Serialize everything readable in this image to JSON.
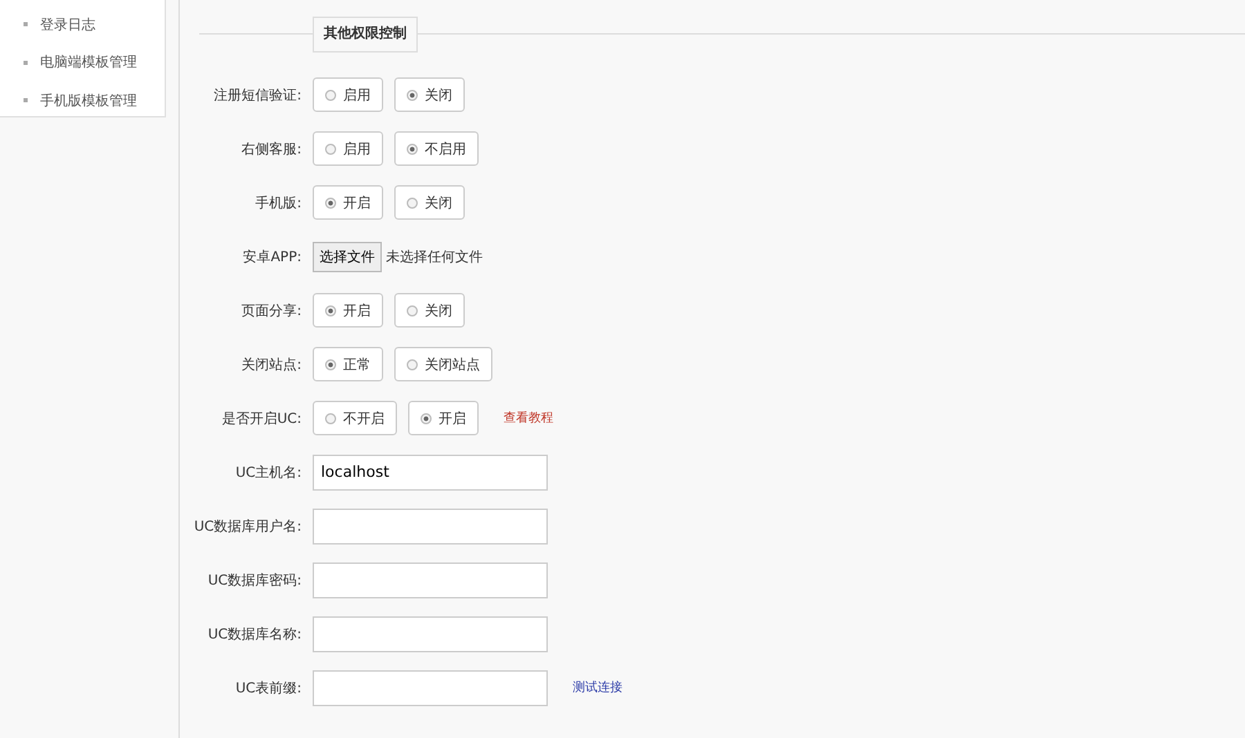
{
  "sidebar": {
    "items": [
      {
        "label": "登录日志"
      },
      {
        "label": "电脑端模板管理"
      },
      {
        "label": "手机版模板管理"
      }
    ]
  },
  "section": {
    "legend": "其他权限控制"
  },
  "rows": [
    {
      "kind": "radio",
      "label": "注册短信验证:",
      "options": [
        {
          "label": "启用",
          "selected": false
        },
        {
          "label": "关闭",
          "selected": true
        }
      ]
    },
    {
      "kind": "radio",
      "label": "右侧客服:",
      "options": [
        {
          "label": "启用",
          "selected": false
        },
        {
          "label": "不启用",
          "selected": true
        }
      ]
    },
    {
      "kind": "radio",
      "label": "手机版:",
      "options": [
        {
          "label": "开启",
          "selected": true
        },
        {
          "label": "关闭",
          "selected": false
        }
      ]
    },
    {
      "kind": "file",
      "label": "安卓APP:",
      "button": "选择文件",
      "status": "未选择任何文件"
    },
    {
      "kind": "radio",
      "label": "页面分享:",
      "options": [
        {
          "label": "开启",
          "selected": true
        },
        {
          "label": "关闭",
          "selected": false
        }
      ]
    },
    {
      "kind": "radio",
      "label": "关闭站点:",
      "options": [
        {
          "label": "正常",
          "selected": true
        },
        {
          "label": "关闭站点",
          "selected": false
        }
      ]
    },
    {
      "kind": "radio",
      "label": "是否开启UC:",
      "options": [
        {
          "label": "不开启",
          "selected": false
        },
        {
          "label": "开启",
          "selected": true
        }
      ],
      "link": {
        "text": "查看教程",
        "color": "#c0392b"
      }
    },
    {
      "kind": "input",
      "label": "UC主机名:",
      "value": "localhost"
    },
    {
      "kind": "input",
      "label": "UC数据库用户名:"
    },
    {
      "kind": "input",
      "label": "UC数据库密码:"
    },
    {
      "kind": "input",
      "label": "UC数据库名称:"
    },
    {
      "kind": "input",
      "label": "UC表前缀:",
      "link": {
        "text": "测试连接",
        "color": "#2d3ca8"
      }
    }
  ]
}
